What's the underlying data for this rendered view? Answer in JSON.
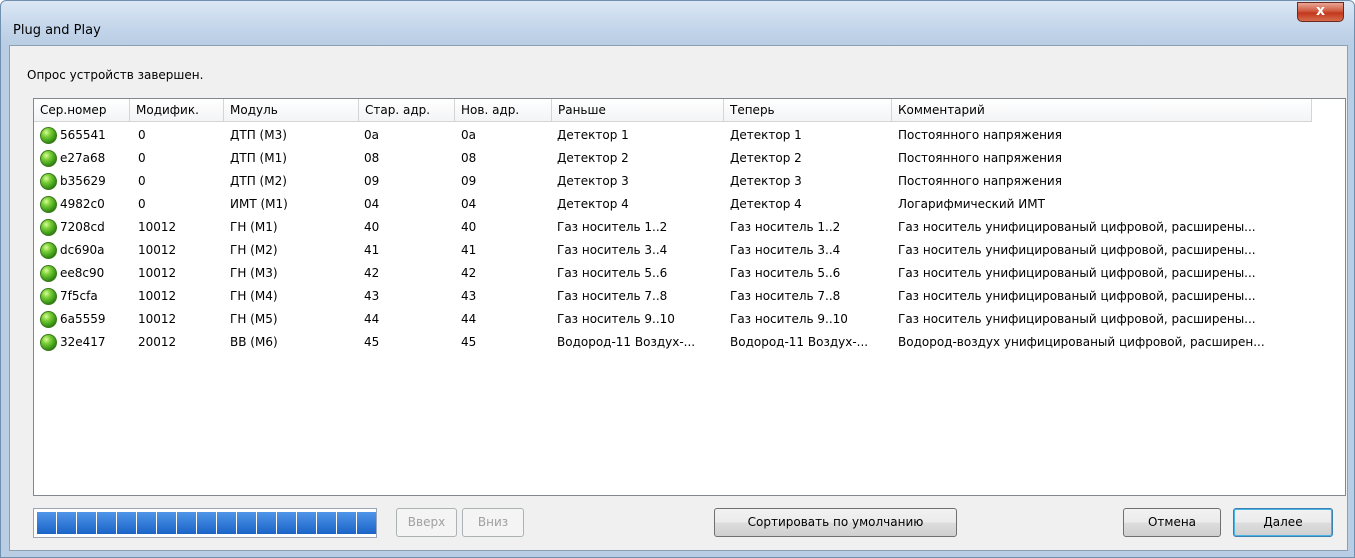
{
  "window": {
    "title": "Plug and Play",
    "close_label": "x"
  },
  "status_text": "Опрос устройств завершен.",
  "columns": [
    "Сер.номер",
    "Модифик.",
    "Модуль",
    "Стар. адр.",
    "Нов. адр.",
    "Раньше",
    "Теперь",
    "Комментарий"
  ],
  "rows": [
    {
      "serial": "565541",
      "mod": "0",
      "module": "ДТП (М3)",
      "old_addr": "0a",
      "new_addr": "0a",
      "before": "Детектор 1",
      "now": "Детектор 1",
      "comment": "Постоянного напряжения"
    },
    {
      "serial": "e27a68",
      "mod": "0",
      "module": "ДТП (М1)",
      "old_addr": "08",
      "new_addr": "08",
      "before": "Детектор 2",
      "now": "Детектор 2",
      "comment": "Постоянного напряжения"
    },
    {
      "serial": "b35629",
      "mod": "0",
      "module": "ДТП (М2)",
      "old_addr": "09",
      "new_addr": "09",
      "before": "Детектор 3",
      "now": "Детектор 3",
      "comment": "Постоянного напряжения"
    },
    {
      "serial": "4982c0",
      "mod": "0",
      "module": "ИМТ (М1)",
      "old_addr": "04",
      "new_addr": "04",
      "before": "Детектор 4",
      "now": "Детектор 4",
      "comment": "Логарифмический ИМТ"
    },
    {
      "serial": "7208cd",
      "mod": "10012",
      "module": "ГН (М1)",
      "old_addr": "40",
      "new_addr": "40",
      "before": "Газ носитель 1..2",
      "now": "Газ носитель 1..2",
      "comment": "Газ носитель унифицированый цифровой, расширены..."
    },
    {
      "serial": "dc690a",
      "mod": "10012",
      "module": "ГН (М2)",
      "old_addr": "41",
      "new_addr": "41",
      "before": "Газ носитель 3..4",
      "now": "Газ носитель 3..4",
      "comment": "Газ носитель унифицированый цифровой, расширены..."
    },
    {
      "serial": "ee8c90",
      "mod": "10012",
      "module": "ГН (М3)",
      "old_addr": "42",
      "new_addr": "42",
      "before": "Газ носитель 5..6",
      "now": "Газ носитель 5..6",
      "comment": "Газ носитель унифицированый цифровой, расширены..."
    },
    {
      "serial": "7f5cfa",
      "mod": "10012",
      "module": "ГН (М4)",
      "old_addr": "43",
      "new_addr": "43",
      "before": "Газ носитель 7..8",
      "now": "Газ носитель 7..8",
      "comment": "Газ носитель унифицированый цифровой, расширены..."
    },
    {
      "serial": "6a5559",
      "mod": "10012",
      "module": "ГН (М5)",
      "old_addr": "44",
      "new_addr": "44",
      "before": "Газ носитель 9..10",
      "now": "Газ носитель 9..10",
      "comment": "Газ носитель унифицированый цифровой, расширены..."
    },
    {
      "serial": "32e417",
      "mod": "20012",
      "module": "ВВ (М6)",
      "old_addr": "45",
      "new_addr": "45",
      "before": "Водород-11 Воздух-...",
      "now": "Водород-11 Воздух-...",
      "comment": "Водород-воздух унифицированый цифровой, расширен..."
    }
  ],
  "row_icon": "green-led-icon",
  "progress": {
    "value": 1.0,
    "segments": 17
  },
  "buttons": {
    "up": "Вверх",
    "down": "Вниз",
    "sort_default": "Сортировать по умолчанию",
    "cancel": "Отмена",
    "next": "Далее"
  },
  "colors": {
    "progress": "#1a64c8",
    "status_led": "#4caf1f"
  }
}
